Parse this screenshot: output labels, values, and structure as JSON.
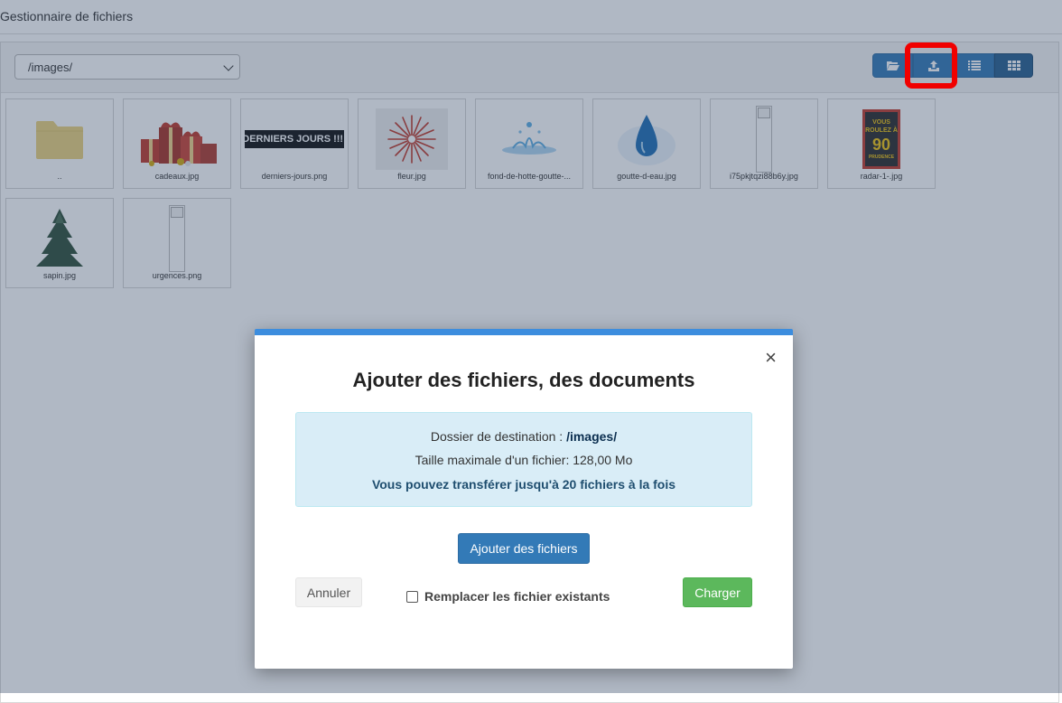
{
  "app": {
    "title": "Gestionnaire de fichiers"
  },
  "toolbar": {
    "folder_select_value": "/images/",
    "buttons": [
      "folder-open-icon",
      "upload-icon",
      "list-view-icon",
      "grid-view-icon"
    ]
  },
  "files": [
    {
      "name": "..",
      "kind": "folder"
    },
    {
      "name": "cadeaux.jpg",
      "kind": "image"
    },
    {
      "name": "derniers-jours.png",
      "kind": "image",
      "thumb_text": "DERNIERS JOURS !!!!"
    },
    {
      "name": "fleur.jpg",
      "kind": "image"
    },
    {
      "name": "fond-de-hotte-goutte-...",
      "kind": "image"
    },
    {
      "name": "goutte-d-eau.jpg",
      "kind": "image"
    },
    {
      "name": "i75pkjtqzi88b6y.jpg",
      "kind": "broken"
    },
    {
      "name": "radar-1-.jpg",
      "kind": "image",
      "thumb_text": [
        "VOUS",
        "ROULEZ À",
        "90",
        "PRUDENCE"
      ]
    },
    {
      "name": "sapin.jpg",
      "kind": "image"
    },
    {
      "name": "urgences.png",
      "kind": "broken"
    }
  ],
  "modal": {
    "title": "Ajouter des fichiers, des documents",
    "destination_label": "Dossier de destination : ",
    "destination_value": "/images/",
    "max_size": "Taille maximale d'un fichier: 128,00 Mo",
    "limit_notice": "Vous pouvez transférer jusqu'à 20 fichiers à la fois",
    "add_files_label": "Ajouter des fichiers",
    "cancel_label": "Annuler",
    "replace_label": "Remplacer les fichier existants",
    "replace_checked": false,
    "upload_label": "Charger",
    "close_symbol": "×"
  },
  "colors": {
    "primary": "#337ab7",
    "success": "#5cb85c",
    "info_bg": "#d9edf7",
    "modal_accent": "#3c8dde",
    "annotation": "#f10000"
  }
}
